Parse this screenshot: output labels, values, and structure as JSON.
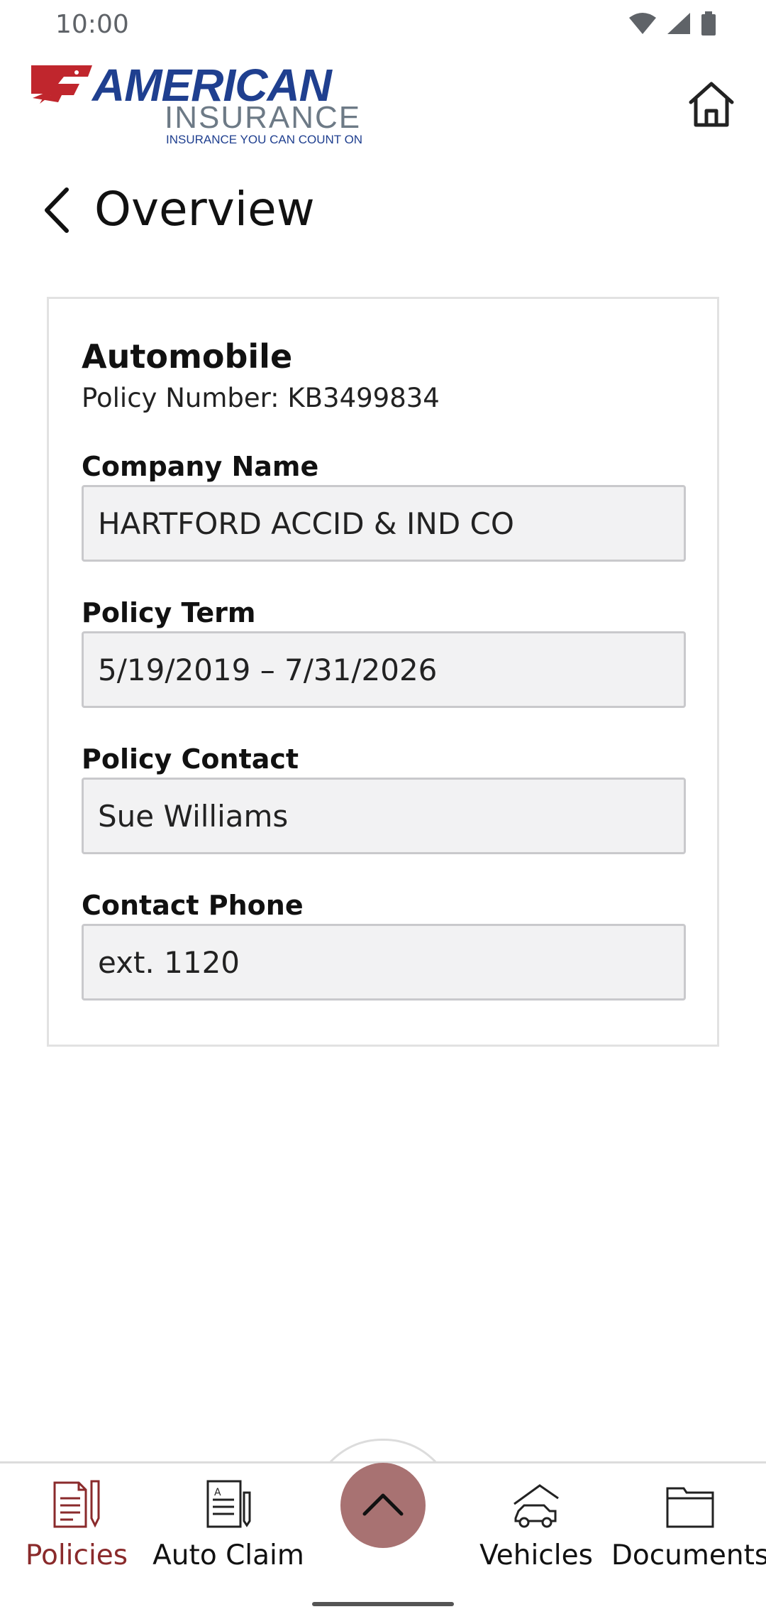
{
  "status_bar": {
    "time": "10:00",
    "icons": [
      "wifi-icon",
      "cell-signal-icon",
      "battery-icon"
    ]
  },
  "header": {
    "logo": {
      "brand": "AMERICAN",
      "sub": "INSURANCE",
      "tagline": "INSURANCE YOU CAN COUNT ON"
    },
    "home_icon": "home-icon"
  },
  "page": {
    "title": "Overview",
    "back_icon": "chevron-left-icon"
  },
  "policy": {
    "type": "Automobile",
    "number_line": "Policy Number: KB3499834",
    "fields": [
      {
        "label": "Company Name",
        "value": "HARTFORD ACCID & IND CO"
      },
      {
        "label": "Policy Term",
        "value": "5/19/2019 – 7/31/2026"
      },
      {
        "label": "Policy Contact",
        "value": "Sue Williams"
      },
      {
        "label": "Contact Phone",
        "value": "ext. 1120"
      }
    ]
  },
  "bottom_nav": {
    "items": [
      {
        "label": "Policies",
        "icon": "policies-icon",
        "active": true
      },
      {
        "label": "Auto Claim",
        "icon": "auto-claim-icon",
        "active": false
      },
      {
        "label": "Vehicles",
        "icon": "vehicles-icon",
        "active": false
      },
      {
        "label": "Documents",
        "icon": "documents-icon",
        "active": false
      }
    ],
    "fab_icon": "chevron-up-icon"
  },
  "colors": {
    "brand_blue": "#1f3f8f",
    "brand_red": "#c0262d",
    "brand_gray": "#6d7a86",
    "active_nav": "#8a2a2b",
    "fab": "#a87272"
  }
}
